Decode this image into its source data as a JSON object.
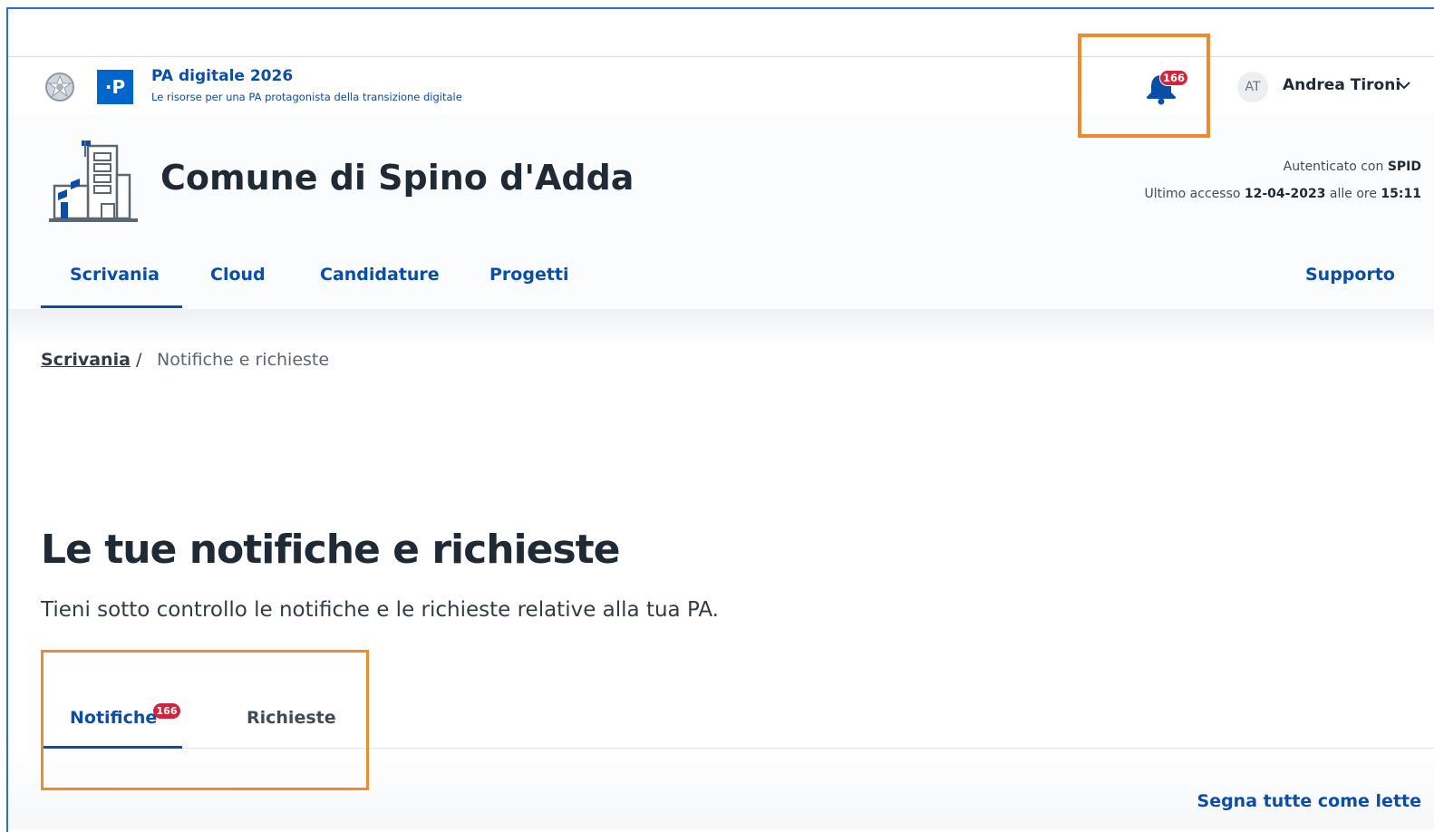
{
  "topbar": {
    "brand_title": "PA digitale 2026",
    "brand_subtitle": "Le risorse per una PA protagonista della transizione digitale",
    "brand_logo_text": "·P",
    "notifications_count": "166",
    "user_initials": "AT",
    "user_name": "Andrea Tironi"
  },
  "header": {
    "entity_name": "Comune di Spino d'Adda",
    "auth_label": "Autenticato con",
    "auth_method": "SPID",
    "last_access_label": "Ultimo accesso",
    "last_access_date": "12-04-2023",
    "last_access_mid": "alle ore",
    "last_access_time": "15:11"
  },
  "nav": {
    "items": [
      "Scrivania",
      "Cloud",
      "Candidature",
      "Progetti"
    ],
    "support": "Supporto"
  },
  "breadcrumb": {
    "link": "Scrivania",
    "separator": "/",
    "current": "Notifiche e richieste"
  },
  "page": {
    "title": "Le tue notifiche e richieste",
    "description": "Tieni sotto controllo le notifiche e le richieste relative alla tua PA."
  },
  "tabs": {
    "notifications": "Notifiche",
    "notifications_badge": "166",
    "requests": "Richieste"
  },
  "actions": {
    "mark_all_read": "Segna tutte come lette"
  },
  "colors": {
    "primary": "#0a4ea8",
    "badge": "#d1253c",
    "highlight": "#f08a2a"
  }
}
